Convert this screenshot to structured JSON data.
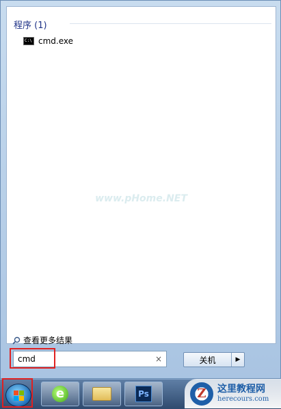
{
  "results": {
    "group_title": "程序 (1)",
    "items": [
      {
        "label": "cmd.exe",
        "icon": "cmd-icon"
      }
    ]
  },
  "watermark_text": "www.pHome.NET",
  "see_more_label": "查看更多结果",
  "search": {
    "value": "cmd",
    "clear_glyph": "×"
  },
  "shutdown": {
    "label": "关机",
    "arrow_glyph": "▶"
  },
  "taskbar": {
    "ps_label": "Ps"
  },
  "site_logo": {
    "mark": "Z",
    "title": "这里教程网",
    "url": "herecours.com"
  },
  "colors": {
    "highlight": "#e02020",
    "group_title": "#1e3287"
  }
}
